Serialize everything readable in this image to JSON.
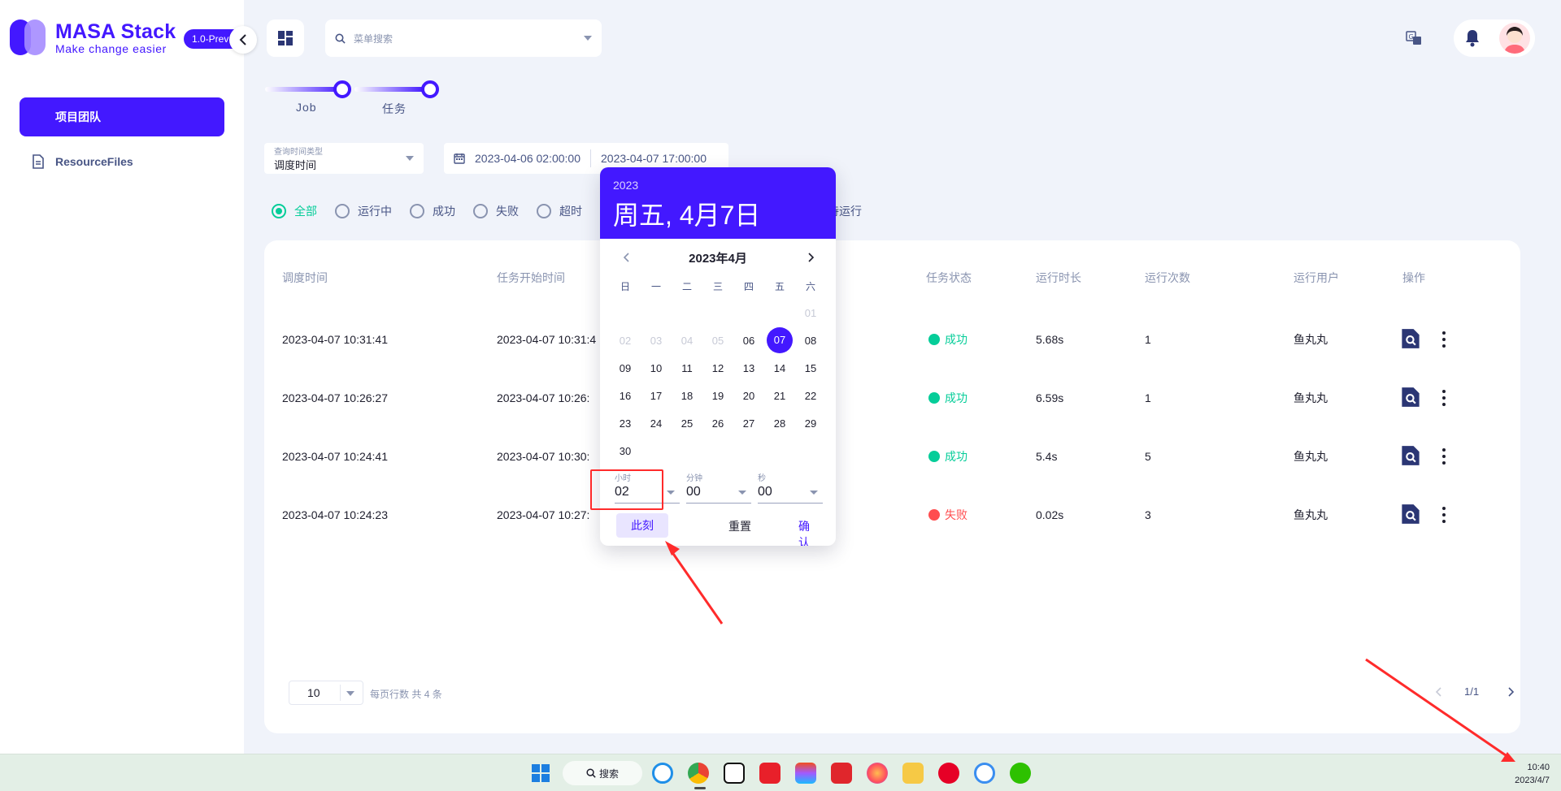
{
  "app": {
    "title": "MASA Stack",
    "subtitle": "Make change easier",
    "version": "1.0-Prev"
  },
  "sidebar": {
    "items": [
      {
        "label": "项目团队",
        "active": true
      },
      {
        "label": "ResourceFiles",
        "active": false
      }
    ]
  },
  "topbar": {
    "search_placeholder": "菜单搜索"
  },
  "stepper": {
    "steps": [
      {
        "label": "Job"
      },
      {
        "label": "任务"
      }
    ]
  },
  "filters": {
    "time_type_label": "查询时间类型",
    "time_type_value": "调度时间",
    "range_start": "2023-04-06 02:00:00",
    "range_end": "2023-04-07 17:00:00",
    "status_options": [
      "全部",
      "运行中",
      "成功",
      "失败",
      "超时"
    ],
    "status_tail": "待运行",
    "selected_status": "全部"
  },
  "table": {
    "headers": [
      "调度时间",
      "任务开始时间",
      "任务状态",
      "运行时长",
      "运行次数",
      "运行用户",
      "操作"
    ],
    "rows": [
      {
        "schedule": "2023-04-07 10:31:41",
        "start": "2023-04-07 10:31:4",
        "status": "成功",
        "status_color": "#05cd99",
        "duration": "5.68s",
        "count": "1",
        "user": "鱼丸丸"
      },
      {
        "schedule": "2023-04-07 10:26:27",
        "start": "2023-04-07 10:26:",
        "status": "成功",
        "status_color": "#05cd99",
        "duration": "6.59s",
        "count": "1",
        "user": "鱼丸丸"
      },
      {
        "schedule": "2023-04-07 10:24:41",
        "start": "2023-04-07 10:30:",
        "status": "成功",
        "status_color": "#05cd99",
        "duration": "5.4s",
        "count": "5",
        "user": "鱼丸丸"
      },
      {
        "schedule": "2023-04-07 10:24:23",
        "start": "2023-04-07 10:27:",
        "status": "失败",
        "status_color": "#ff4d4f",
        "duration": "0.02s",
        "count": "3",
        "user": "鱼丸丸"
      }
    ]
  },
  "pagination": {
    "page_size": "10",
    "rows_per_page_label": "每页行数",
    "total_label": "共 4 条",
    "page_info": "1/1"
  },
  "datepicker": {
    "year": "2023",
    "selected_date_label": "周五, 4月7日",
    "month_title": "2023年4月",
    "weekdays": [
      "日",
      "一",
      "二",
      "三",
      "四",
      "五",
      "六"
    ],
    "days": [
      [
        "",
        "",
        "",
        "",
        "",
        "",
        "01"
      ],
      [
        "02",
        "03",
        "04",
        "05",
        "06",
        "07",
        "08"
      ],
      [
        "09",
        "10",
        "11",
        "12",
        "13",
        "14",
        "15"
      ],
      [
        "16",
        "17",
        "18",
        "19",
        "20",
        "21",
        "22"
      ],
      [
        "23",
        "24",
        "25",
        "26",
        "27",
        "28",
        "29"
      ],
      [
        "30",
        "",
        "",
        "",
        "",
        "",
        ""
      ]
    ],
    "disabled_days": [
      "01",
      "02",
      "03",
      "04",
      "05"
    ],
    "selected_day": "07",
    "hour_label": "小时",
    "hour_value": "02",
    "minute_label": "分钟",
    "minute_value": "00",
    "second_label": "秒",
    "second_value": "00",
    "now_button": "此刻",
    "reset_button": "重置",
    "confirm_button": "确认"
  },
  "taskbar": {
    "search_label": "搜索",
    "time": "10:40",
    "date": "2023/4/7"
  },
  "colors": {
    "primary": "#4318ff",
    "success": "#05cd99",
    "danger": "#ff4d4f",
    "annotation": "#ff2b2b"
  }
}
